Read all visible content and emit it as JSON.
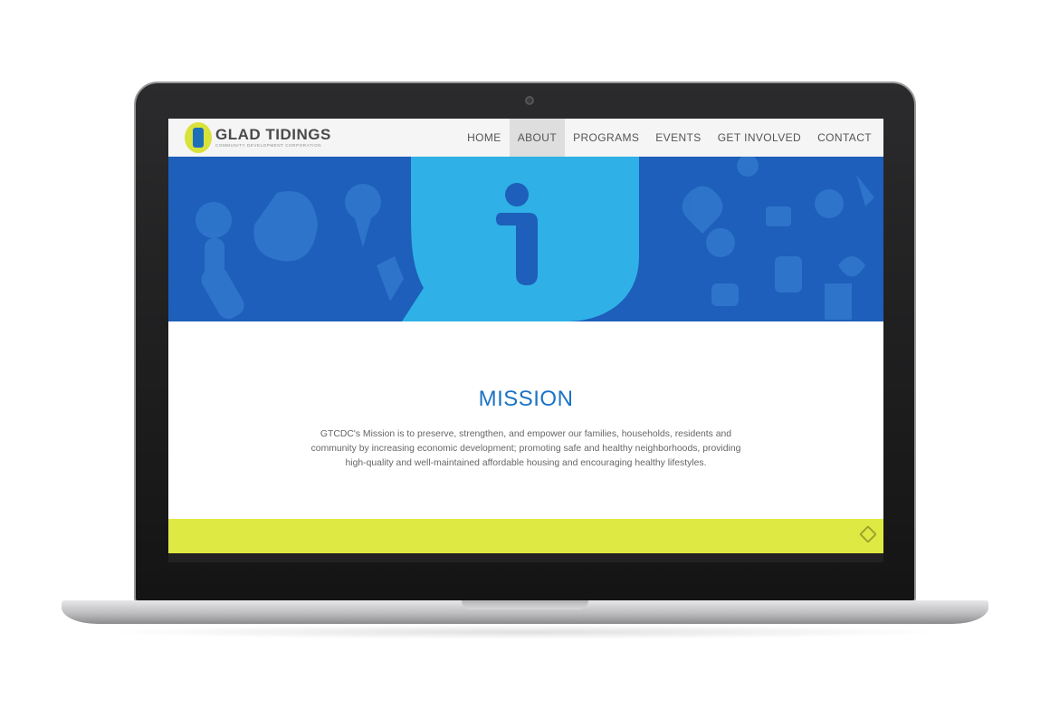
{
  "header": {
    "logo_title": "GLAD TIDINGS",
    "logo_subtitle": "COMMUNITY DEVELOPMENT CORPORATION",
    "nav": [
      {
        "label": "HOME"
      },
      {
        "label": "ABOUT"
      },
      {
        "label": "PROGRAMS"
      },
      {
        "label": "EVENTS"
      },
      {
        "label": "GET INVOLVED"
      },
      {
        "label": "CONTACT"
      }
    ],
    "active_nav": "ABOUT"
  },
  "hero": {
    "icon": "info-icon",
    "background_color": "#1d5fba",
    "bubble_color": "#2fb0e6"
  },
  "mission": {
    "title": "MISSION",
    "body": "GTCDC's Mission is to preserve, strengthen, and empower our families, households, residents and community by increasing economic development; promoting safe and healthy neighborhoods, providing high-quality and well-maintained affordable housing and encouraging healthy lifestyles."
  },
  "footer": {
    "band_color": "#dfe943",
    "icon": "diamond-icon"
  },
  "colors": {
    "accent": "#1b73c6",
    "nav_active_bg": "#dedede"
  }
}
